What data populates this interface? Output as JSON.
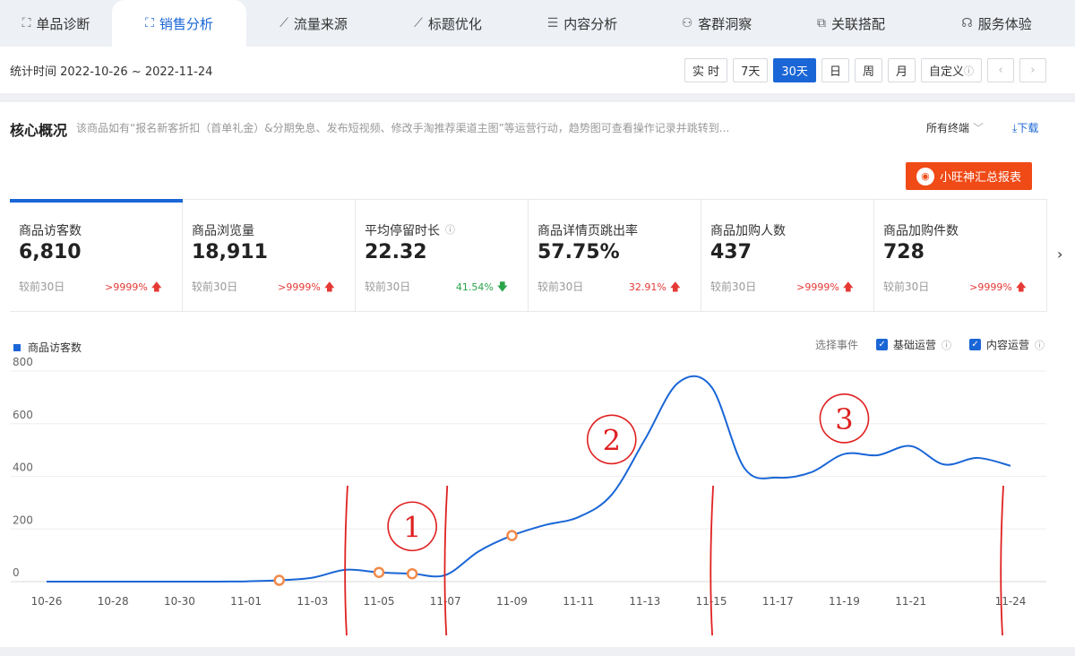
{
  "tabs": [
    {
      "label": "单品诊断",
      "icon": "bag-icon",
      "active": false
    },
    {
      "label": "销售分析",
      "icon": "bag-icon",
      "active": true
    },
    {
      "label": "流量来源",
      "icon": "line-chart-icon",
      "active": false
    },
    {
      "label": "标题优化",
      "icon": "line-chart-icon",
      "active": false
    },
    {
      "label": "内容分析",
      "icon": "document-icon",
      "active": false
    },
    {
      "label": "客群洞察",
      "icon": "people-icon",
      "active": false
    },
    {
      "label": "关联搭配",
      "icon": "link-icon",
      "active": false
    },
    {
      "label": "服务体验",
      "icon": "headset-icon",
      "active": false
    }
  ],
  "period": "统计时间 2022-10-26 ~ 2022-11-24",
  "range_buttons": [
    {
      "label": "实 时",
      "active": false
    },
    {
      "label": "7天",
      "active": false
    },
    {
      "label": "30天",
      "active": true
    },
    {
      "label": "日",
      "active": false
    },
    {
      "label": "周",
      "active": false
    },
    {
      "label": "月",
      "active": false
    },
    {
      "label": "自定义",
      "active": false
    }
  ],
  "core": {
    "title": "核心概况",
    "desc": "该商品如有“报名新客折扣（首单礼金）&分期免息、发布短视频、修改手淘推荐渠道主图”等运营行动，趋势图可查看操作记录并跳转到...",
    "terminal": "所有终端",
    "download": "下载",
    "report_button": "小旺神汇总报表"
  },
  "metrics": [
    {
      "label": "商品访客数",
      "value": "6,810",
      "cmp": "较前30日",
      "change": ">9999%",
      "dir": "up"
    },
    {
      "label": "商品浏览量",
      "value": "18,911",
      "cmp": "较前30日",
      "change": ">9999%",
      "dir": "up"
    },
    {
      "label": "平均停留时长",
      "value": "22.32",
      "cmp": "较前30日",
      "change": "41.54%",
      "dir": "down"
    },
    {
      "label": "商品详情页跳出率",
      "value": "57.75%",
      "cmp": "较前30日",
      "change": "32.91%",
      "dir": "up"
    },
    {
      "label": "商品加购人数",
      "value": "437",
      "cmp": "较前30日",
      "change": ">9999%",
      "dir": "up"
    },
    {
      "label": "商品加购件数",
      "value": "728",
      "cmp": "较前30日",
      "change": ">9999%",
      "dir": "up"
    }
  ],
  "events": {
    "select_label": "选择事件",
    "options": [
      {
        "label": "基础运营",
        "checked": true
      },
      {
        "label": "内容运营",
        "checked": true
      }
    ]
  },
  "colors": {
    "accent": "#1a66d6",
    "annotation": "#e02020",
    "event_marker": "#f08a4b",
    "report_button": "#f04a16"
  },
  "chart_data": {
    "type": "line",
    "legend": "top-left",
    "ylim": [
      0,
      800
    ],
    "yticks": [
      0,
      200,
      400,
      600,
      800
    ],
    "xtick_labels": [
      "10-26",
      "10-28",
      "10-30",
      "11-01",
      "11-03",
      "11-05",
      "11-07",
      "11-09",
      "11-11",
      "11-13",
      "11-15",
      "11-17",
      "11-19",
      "11-21",
      "11-24"
    ],
    "x": [
      "10-26",
      "10-27",
      "10-28",
      "10-29",
      "10-30",
      "10-31",
      "11-01",
      "11-02",
      "11-03",
      "11-04",
      "11-05",
      "11-06",
      "11-07",
      "11-08",
      "11-09",
      "11-10",
      "11-11",
      "11-12",
      "11-13",
      "11-14",
      "11-15",
      "11-16",
      "11-17",
      "11-18",
      "11-19",
      "11-20",
      "11-21",
      "11-22",
      "11-23",
      "11-24"
    ],
    "series": [
      {
        "name": "商品访客数",
        "values": [
          0,
          0,
          0,
          0,
          0,
          0,
          1,
          5,
          15,
          45,
          35,
          30,
          25,
          115,
          175,
          215,
          245,
          330,
          540,
          755,
          740,
          430,
          395,
          415,
          485,
          480,
          515,
          445,
          470,
          440
        ]
      }
    ],
    "event_markers": [
      "11-02",
      "11-05",
      "11-06",
      "11-09"
    ],
    "annotations": {
      "vertical_lines": [
        "11-04",
        "11-07",
        "11-15",
        "11-24"
      ],
      "labels": [
        {
          "text": "1",
          "x": "11-06",
          "y": 210
        },
        {
          "text": "2",
          "x": "11-12",
          "y": 540
        },
        {
          "text": "3",
          "x": "11-19",
          "y": 620
        }
      ]
    }
  }
}
